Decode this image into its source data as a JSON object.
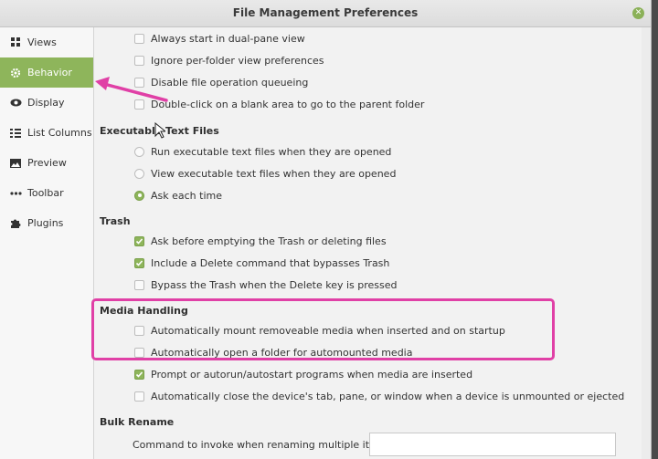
{
  "window": {
    "title": "File Management Preferences"
  },
  "sidebar": {
    "items": [
      {
        "label": "Views",
        "icon": "grid-icon",
        "active": false
      },
      {
        "label": "Behavior",
        "icon": "gear-icon",
        "active": true
      },
      {
        "label": "Display",
        "icon": "eye-icon",
        "active": false
      },
      {
        "label": "List Columns",
        "icon": "list-icon",
        "active": false
      },
      {
        "label": "Preview",
        "icon": "image-icon",
        "active": false
      },
      {
        "label": "Toolbar",
        "icon": "dots-icon",
        "active": false
      },
      {
        "label": "Plugins",
        "icon": "puzzle-icon",
        "active": false
      }
    ]
  },
  "behavior": {
    "general": [
      {
        "label": "Always start in dual-pane view",
        "checked": false
      },
      {
        "label": "Ignore per-folder view preferences",
        "checked": false
      },
      {
        "label": "Disable file operation queueing",
        "checked": false
      },
      {
        "label": "Double-click on a blank area to go to the parent folder",
        "checked": false
      }
    ],
    "executable": {
      "title": "Executable Text Files",
      "options": [
        {
          "label": "Run executable text files when they are opened",
          "selected": false
        },
        {
          "label": "View executable text files when they are opened",
          "selected": false
        },
        {
          "label": "Ask each time",
          "selected": true
        }
      ]
    },
    "trash": {
      "title": "Trash",
      "options": [
        {
          "label": "Ask before emptying the Trash or deleting files",
          "checked": true
        },
        {
          "label": "Include a Delete command that bypasses Trash",
          "checked": true
        },
        {
          "label": "Bypass the Trash when the Delete key is pressed",
          "checked": false
        }
      ]
    },
    "media": {
      "title": "Media Handling",
      "options": [
        {
          "label": "Automatically mount removeable media when inserted and on startup",
          "checked": false
        },
        {
          "label": "Automatically open a folder for automounted media",
          "checked": false
        },
        {
          "label": "Prompt or autorun/autostart programs when media are inserted",
          "checked": true
        },
        {
          "label": "Automatically close the device's tab, pane, or window when a device is unmounted or ejected",
          "checked": false
        }
      ]
    },
    "bulk_rename": {
      "title": "Bulk Rename",
      "command_label": "Command to invoke when renaming multiple items:",
      "command_value": ""
    }
  },
  "colors": {
    "accent": "#8eb55b",
    "annotation": "#e040a6"
  }
}
